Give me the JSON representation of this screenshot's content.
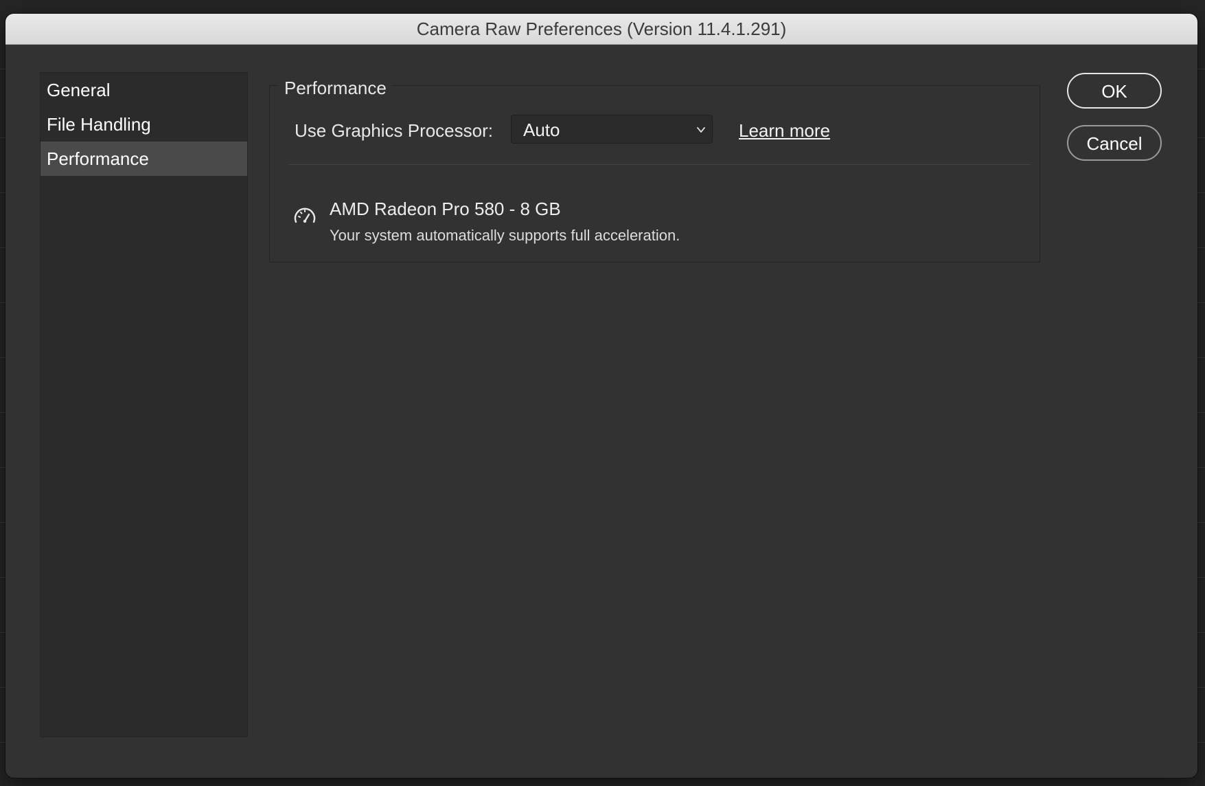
{
  "window": {
    "title": "Camera Raw Preferences  (Version 11.4.1.291)"
  },
  "sidebar": {
    "items": [
      {
        "label": "General"
      },
      {
        "label": "File Handling"
      },
      {
        "label": "Performance"
      }
    ],
    "selected": "Performance"
  },
  "performance": {
    "group_title": "Performance",
    "gpu_label": "Use Graphics Processor:",
    "gpu_select_value": "Auto",
    "learn_more": "Learn more",
    "gpu_name": "AMD Radeon Pro 580 - 8 GB",
    "gpu_status": "Your system automatically supports full acceleration.",
    "gpu_icon": "speedometer-icon"
  },
  "buttons": {
    "ok": "OK",
    "cancel": "Cancel"
  },
  "colors": {
    "dialog_bg": "#323232",
    "sidebar_bg": "#2b2b2b",
    "selected_bg": "#4a4a4a"
  }
}
